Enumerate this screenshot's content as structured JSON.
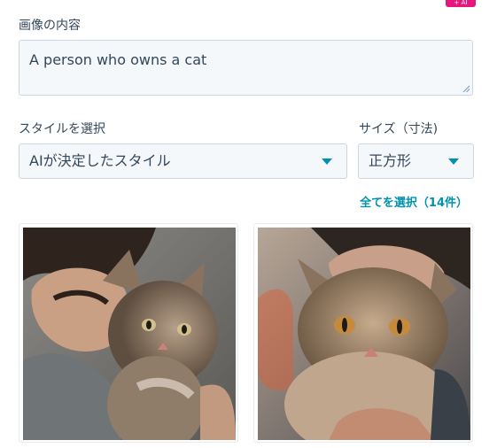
{
  "badge": {
    "text": "+ AI"
  },
  "prompt": {
    "label": "画像の内容",
    "value": "A person who owns a cat"
  },
  "style": {
    "label": "スタイルを選択",
    "selected": "AIが決定したスタイル"
  },
  "size": {
    "label": "サイズ（寸法)",
    "selected": "正方形"
  },
  "select_all": "全てを選択（14件）",
  "images": [
    {
      "icon": "person-hugging-cat-image"
    },
    {
      "icon": "cat-held-by-person-image"
    }
  ],
  "colors": {
    "accent": "#0091ae",
    "field_bg": "#f5f8fa",
    "field_border": "#cbd6e2",
    "text": "#33475b",
    "badge": "#e5177c"
  }
}
